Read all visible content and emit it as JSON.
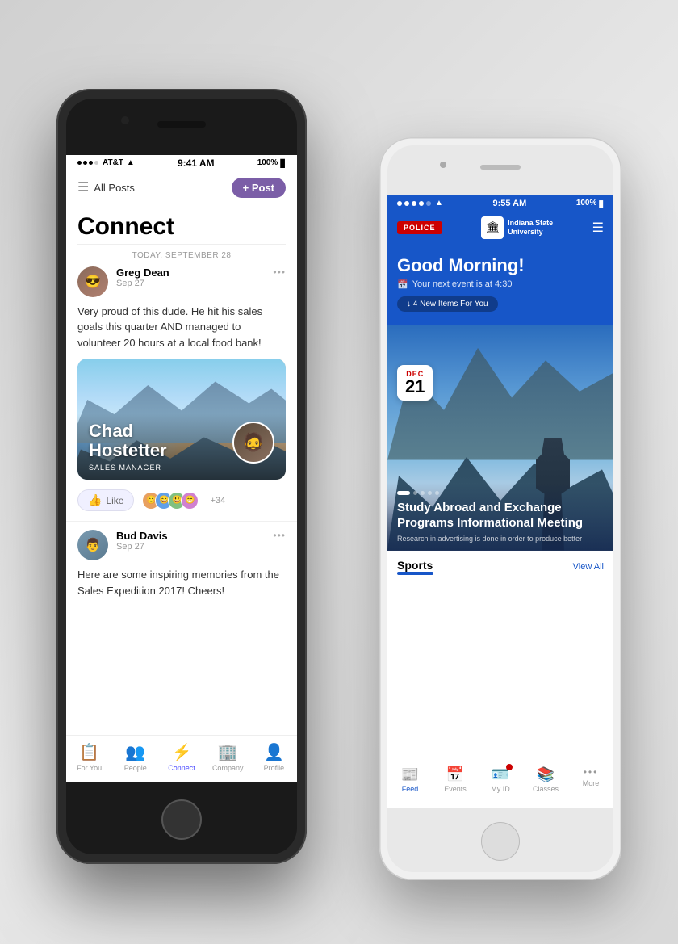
{
  "dark_phone": {
    "status": {
      "carrier": "AT&T",
      "time": "9:41 AM",
      "battery": "100%"
    },
    "header": {
      "filter_label": "All Posts",
      "post_button": "+ Post"
    },
    "page_title": "Connect",
    "date_label": "TODAY, SEPTEMBER 28",
    "post1": {
      "author": "Greg Dean",
      "date": "Sep 27",
      "text": "Very proud of this dude. He hit his sales goals this quarter AND managed to volunteer 20 hours at a local food bank!",
      "more": "•••"
    },
    "featured": {
      "name_line1": "Chad",
      "name_line2": "Hostetter",
      "role": "SALES MANAGER"
    },
    "reactions": {
      "like": "Like",
      "count": "+34"
    },
    "post2": {
      "author": "Bud Davis",
      "date": "Sep 27",
      "text": "Here are some inspiring memories from the Sales Expedition 2017! Cheers!",
      "more": "•••"
    },
    "nav": {
      "items": [
        {
          "label": "For You",
          "icon": "📋",
          "active": false
        },
        {
          "label": "People",
          "icon": "👥",
          "active": false
        },
        {
          "label": "Connect",
          "icon": "⚡",
          "active": true
        },
        {
          "label": "Company",
          "icon": "🏢",
          "active": false
        },
        {
          "label": "Profile",
          "icon": "👤",
          "active": false
        }
      ]
    }
  },
  "white_phone": {
    "status": {
      "time": "9:55 AM",
      "battery": "100%"
    },
    "police_label": "POLICE",
    "university": {
      "name": "Indiana State\nUniversity"
    },
    "greeting": "Good Morning!",
    "next_event": "Your next event is at 4:30",
    "new_items": "↓ 4 New Items For You",
    "event": {
      "month": "DEC",
      "day": "21",
      "title": "Study Abroad and Exchange Programs Informational Meeting",
      "desc": "Research in advertising is done in order to produce better"
    },
    "sports": {
      "label": "Sports",
      "view_all": "View All"
    },
    "nav": {
      "items": [
        {
          "label": "Feed",
          "icon": "📰",
          "active": true
        },
        {
          "label": "Events",
          "icon": "📅",
          "active": false
        },
        {
          "label": "My ID",
          "icon": "🪪",
          "active": false,
          "notif": true
        },
        {
          "label": "Classes",
          "icon": "📚",
          "active": false
        },
        {
          "label": "More",
          "icon": "•••",
          "active": false
        }
      ]
    }
  }
}
